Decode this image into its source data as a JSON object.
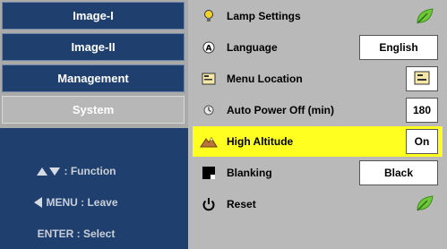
{
  "left_menu": {
    "tabs": [
      {
        "label": "Image-I",
        "selected": false
      },
      {
        "label": "Image-II",
        "selected": false
      },
      {
        "label": "Management",
        "selected": false
      },
      {
        "label": "System",
        "selected": true
      }
    ],
    "help": {
      "function_label": ": Function",
      "leave_label": "MENU : Leave",
      "select_label": "ENTER : Select"
    }
  },
  "settings": {
    "lamp_settings": {
      "label": "Lamp Settings",
      "icon": "bulb-icon",
      "action_icon": "leaf-icon"
    },
    "language": {
      "label": "Language",
      "icon": "language-icon",
      "value": "English"
    },
    "menu_location": {
      "label": "Menu Location",
      "icon": "menu-location-icon",
      "value_icon": "menu-location-value-icon"
    },
    "auto_power_off": {
      "label": "Auto Power Off (min)",
      "icon": "timer-icon",
      "value": "180"
    },
    "high_altitude": {
      "label": "High Altitude",
      "icon": "mountain-icon",
      "value": "On"
    },
    "blanking": {
      "label": "Blanking",
      "icon": "blanking-icon",
      "value": "Black"
    },
    "reset": {
      "label": "Reset",
      "icon": "power-icon",
      "action_icon": "leaf-icon"
    }
  },
  "colors": {
    "tab_background": "#1f3f6e",
    "selected_tab": "#b7b7b7",
    "panel_background": "#b9b9b9",
    "highlight": "#ffff20"
  }
}
